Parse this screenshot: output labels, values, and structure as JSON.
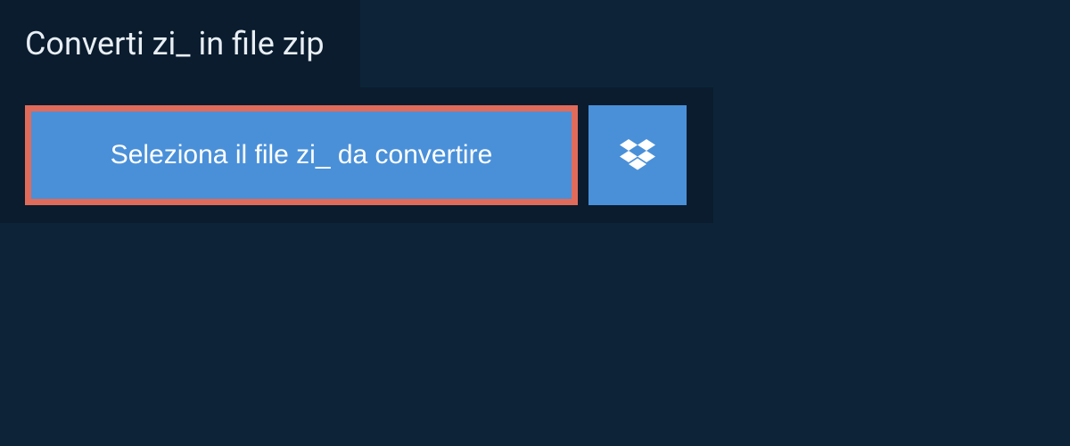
{
  "tab": {
    "title": "Converti zi_ in file zip"
  },
  "main": {
    "select_button_label": "Seleziona il file zi_ da convertire"
  },
  "colors": {
    "background": "#0d2438",
    "panel": "#0a1c2e",
    "button": "#4a90d9",
    "highlight_border": "#e06b5a",
    "text_light": "#e8eef4"
  }
}
